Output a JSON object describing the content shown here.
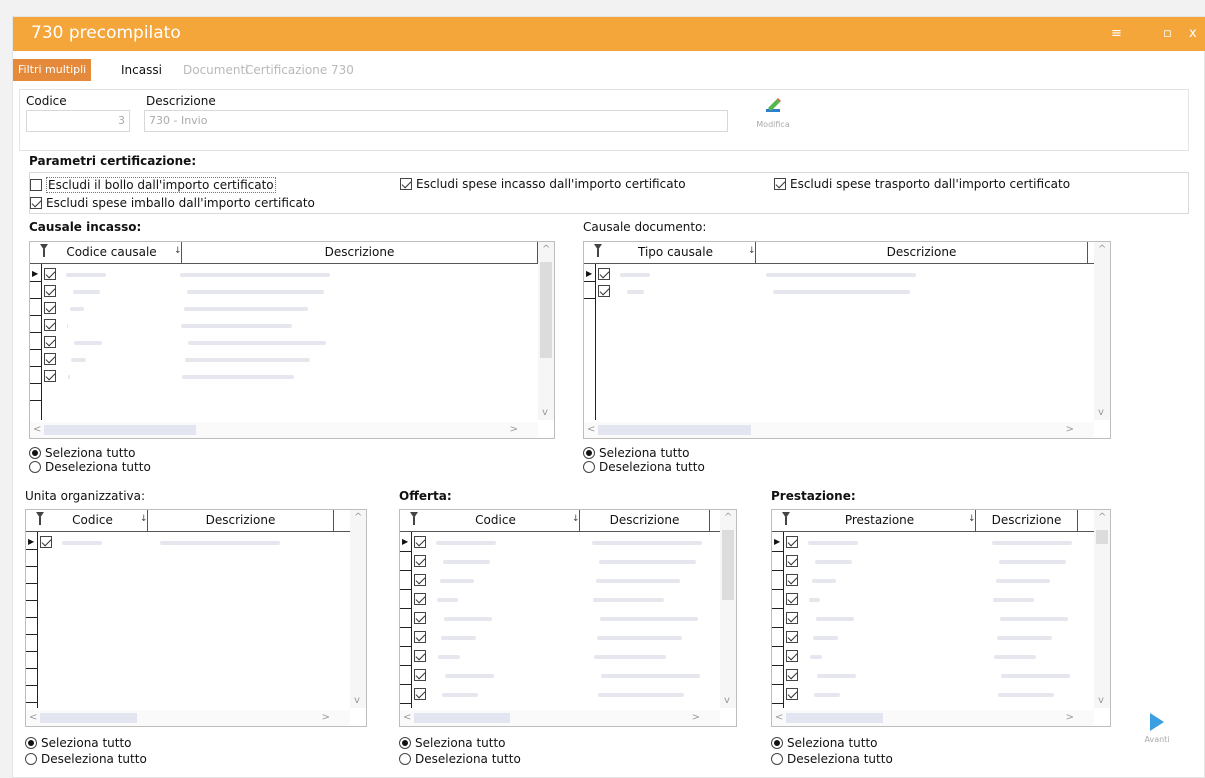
{
  "window": {
    "title": "730 precompilato",
    "menu_glyph": "≡",
    "minimize_glyph": "▫",
    "close_glyph": "x"
  },
  "tabs": [
    {
      "label": "Filtri multipli",
      "state": "active"
    },
    {
      "label": "Incassi",
      "state": "normal"
    },
    {
      "label": "Documenti",
      "state": "disabled"
    },
    {
      "label": "Certificazione 730",
      "state": "disabled"
    }
  ],
  "header": {
    "codice_label": "Codice",
    "codice_value": "3",
    "descrizione_label": "Descrizione",
    "descrizione_value": "730 - Invio",
    "modifica_label": "Modifica"
  },
  "params": {
    "title": "Parametri certificazione:",
    "options": [
      {
        "label": "Escludi il bollo dall'importo certificato",
        "checked": false
      },
      {
        "label": "Escludi spese incasso dall'importo certificato",
        "checked": true
      },
      {
        "label": "Escludi spese trasporto dall'importo certificato",
        "checked": true
      },
      {
        "label": "Escludi spese imballo dall'importo certificato",
        "checked": true
      }
    ]
  },
  "grids": {
    "causale_incasso": {
      "title": "Causale incasso:",
      "columns": [
        "Codice causale",
        "Descrizione"
      ]
    },
    "causale_documento": {
      "title": "Causale documento:",
      "columns": [
        "Tipo causale",
        "Descrizione"
      ]
    },
    "unita_organizzativa": {
      "title": "Unita organizzativa:",
      "columns": [
        "Codice",
        "Descrizione"
      ]
    },
    "offerta": {
      "title": "Offerta:",
      "columns": [
        "Codice",
        "Descrizione"
      ]
    },
    "prestazione": {
      "title": "Prestazione:",
      "columns": [
        "Prestazione",
        "Descrizione"
      ]
    }
  },
  "selection": {
    "select_all": "Seleziona tutto",
    "deselect_all": "Deseleziona tutto"
  },
  "footer": {
    "avanti_label": "Avanti"
  },
  "colors": {
    "titlebar": "#f5a63b",
    "active_tab": "#e5893a",
    "avanti_arrow": "#3a9ee0"
  }
}
